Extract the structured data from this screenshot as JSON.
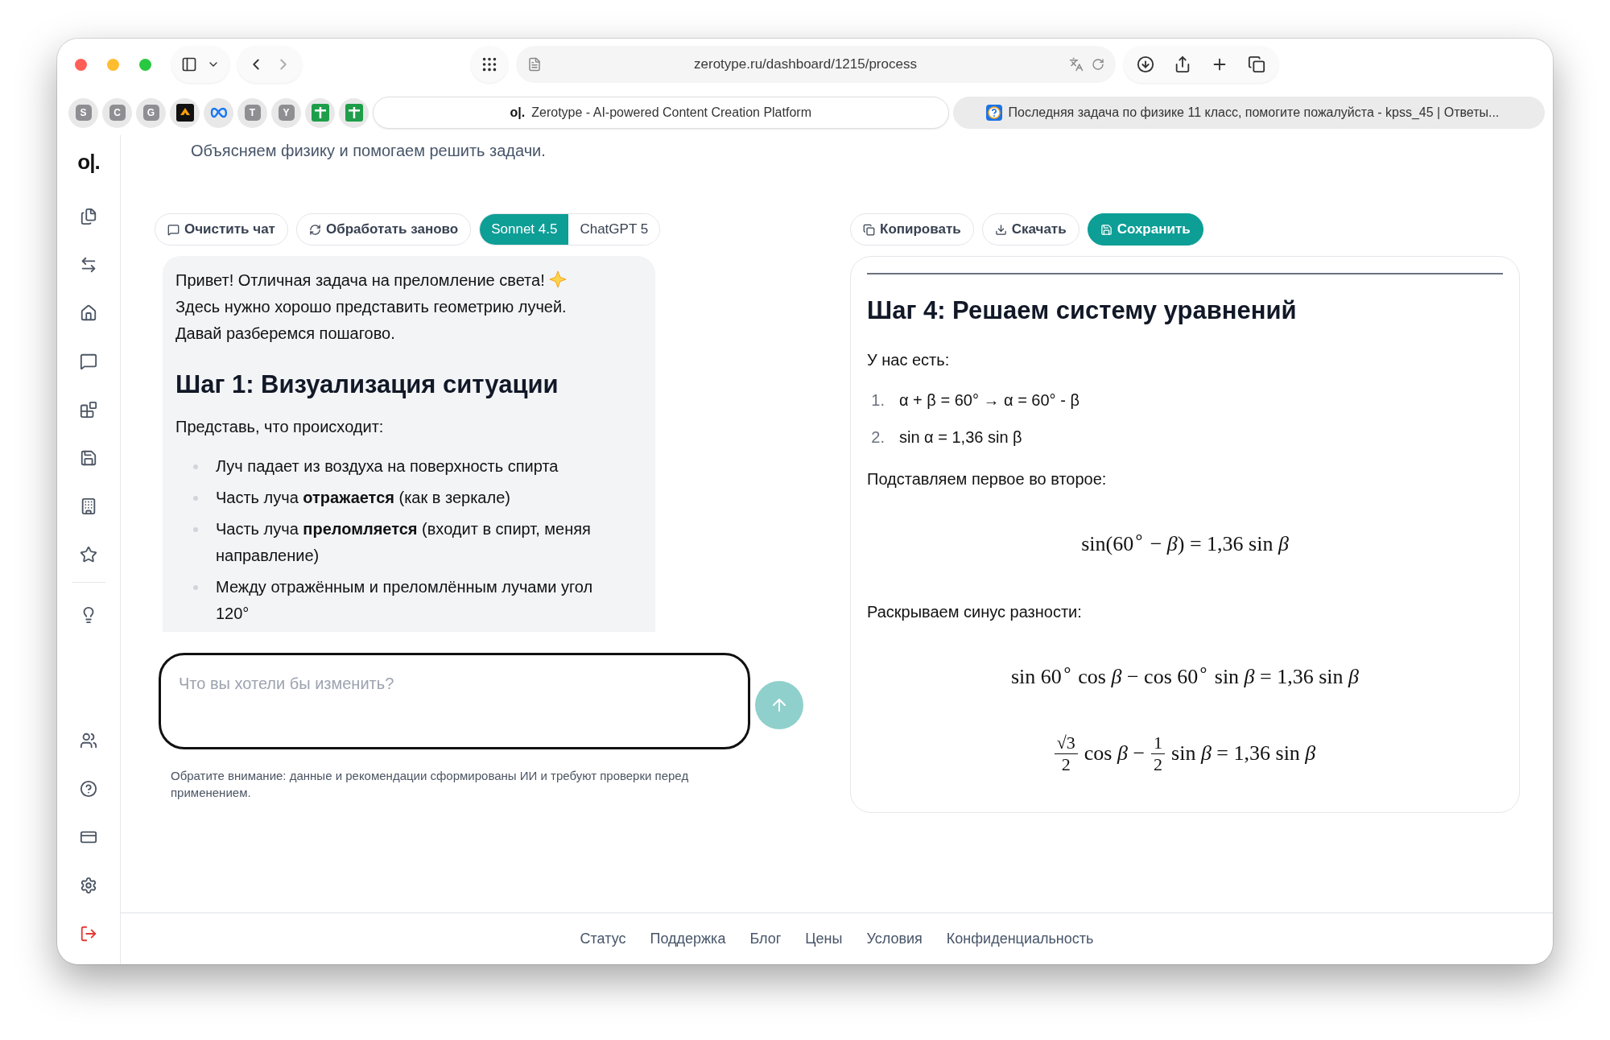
{
  "browser": {
    "url": "zerotype.ru/dashboard/1215/process",
    "bookmarks": [
      {
        "kind": "letter",
        "label": "S"
      },
      {
        "kind": "letter",
        "label": "C"
      },
      {
        "kind": "letter",
        "label": "G"
      },
      {
        "kind": "logo"
      },
      {
        "kind": "infinity"
      },
      {
        "kind": "letter",
        "label": "T"
      },
      {
        "kind": "letter",
        "label": "Y"
      },
      {
        "kind": "sheet"
      },
      {
        "kind": "sheet"
      }
    ],
    "tabs": [
      {
        "title": "Zerotype - AI-powered Content Creation Platform",
        "favicon": "o|.",
        "selected": true
      },
      {
        "title": "Последняя задача по физике 11 класс, помогите пожалуйста - kpss_45 | Ответы...",
        "selected": false
      }
    ]
  },
  "sidebar": {
    "logo": "o|."
  },
  "subtitle": "Объясняем физику и помогаем решить задачи.",
  "chat": {
    "actions": [
      {
        "label": "Очистить чат",
        "kind": "clear"
      },
      {
        "label": "Обработать заново",
        "kind": "retry"
      }
    ],
    "models": [
      {
        "label": "Sonnet 4.5",
        "selected": true
      },
      {
        "label": "ChatGPT 5",
        "selected": false
      }
    ],
    "message": {
      "greeting": "Привет! Отличная задача на преломление света!",
      "intro": "Здесь нужно хорошо представить геометрию лучей. Давай разберемся пошагово.",
      "heading": "Шаг 1: Визуализация ситуации",
      "lead": "Представь, что происходит:",
      "bullets": [
        "Луч падает из воздуха на поверхность спирта",
        "Часть луча **отражается** (как в зеркале)",
        "Часть луча **преломляется** (входит в спирт, меняя направление)",
        "Между отражённым и преломлённым лучами угол 120°"
      ]
    },
    "input": {
      "placeholder": "Что вы хотели бы изменить?"
    },
    "disclaimer": "Обратите внимание: данные и рекомендации сформированы ИИ и требуют проверки перед применением."
  },
  "result": {
    "actions": [
      {
        "label": "Копировать",
        "kind": "copy",
        "primary": false
      },
      {
        "label": "Скачать",
        "kind": "download",
        "primary": false
      },
      {
        "label": "Сохранить",
        "kind": "save",
        "primary": true
      }
    ],
    "heading": "Шаг 4: Решаем систему уравнений",
    "blocks": [
      {
        "kind": "text",
        "text": "У нас есть:"
      },
      {
        "kind": "list",
        "items": [
          {
            "number": "1.",
            "text": "α + β = 60° → α = 60° - β"
          },
          {
            "number": "2.",
            "text": "sin α = 1,36 sin β"
          }
        ]
      },
      {
        "kind": "text",
        "text": "Подставляем первое во второе:"
      },
      {
        "kind": "math",
        "parts": [
          {
            "kind": "text",
            "text": "sin(60$^{∘}$ − *β*) = 1,36 sin *β*"
          }
        ]
      },
      {
        "kind": "text",
        "text": "Раскрываем синус разности:"
      },
      {
        "kind": "math",
        "parts": [
          {
            "kind": "text",
            "text": "sin 60$^{∘}$ cos *β* − cos 60$^{∘}$ sin *β* = 1,36 sin *β*"
          }
        ]
      },
      {
        "kind": "math",
        "parts": [
          {
            "kind": "frac",
            "num": "√3",
            "den": "2"
          },
          {
            "kind": "text",
            "text": "cos *β* −"
          },
          {
            "kind": "frac",
            "num": "1",
            "den": "2"
          },
          {
            "kind": "text",
            "text": "sin *β* = 1,36 sin *β*"
          }
        ]
      }
    ]
  },
  "footer": {
    "links": [
      "Статус",
      "Поддержка",
      "Блог",
      "Цены",
      "Условия",
      "Конфиденциальность"
    ]
  }
}
